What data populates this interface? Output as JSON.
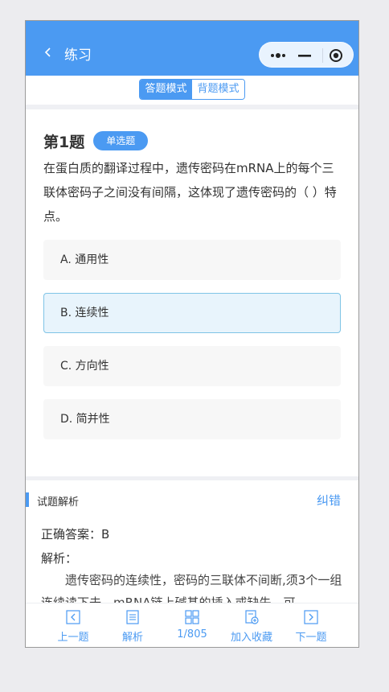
{
  "header": {
    "title": "练习"
  },
  "capsule": {
    "more_icon": "more-dots-icon",
    "minimize_icon": "minimize-icon",
    "close_icon": "target-circle-icon"
  },
  "modes": {
    "answer": "答题模式",
    "recite": "背题模式",
    "active": "answer"
  },
  "question": {
    "number": "第1题",
    "type": "单选题",
    "text": "在蛋白质的翻译过程中，遗传密码在mRNA上的每个三联体密码子之间没有间隔，这体现了遗传密码的（ ）特点。",
    "options": [
      {
        "label": "A. 通用性",
        "selected": false
      },
      {
        "label": "B. 连续性",
        "selected": true
      },
      {
        "label": "C. 方向性",
        "selected": false
      },
      {
        "label": "D. 简并性",
        "selected": false
      }
    ]
  },
  "analysis": {
    "title": "试题解析",
    "report_link": "纠错",
    "answer": "正确答案：B",
    "explanation_label": "解析：",
    "explanation": "遗传密码的连续性，密码的三联体不间断,须3个一组连续读下去。mRNA链上碱基的插入或缺失，可"
  },
  "toolbar": {
    "prev": "上一题",
    "analysis": "解析",
    "progress": "1/805",
    "favorite": "加入收藏",
    "next": "下一题"
  },
  "colors": {
    "primary": "#4b9af2",
    "selected_bg": "#e8f4fc",
    "selected_border": "#7fc4e6"
  }
}
